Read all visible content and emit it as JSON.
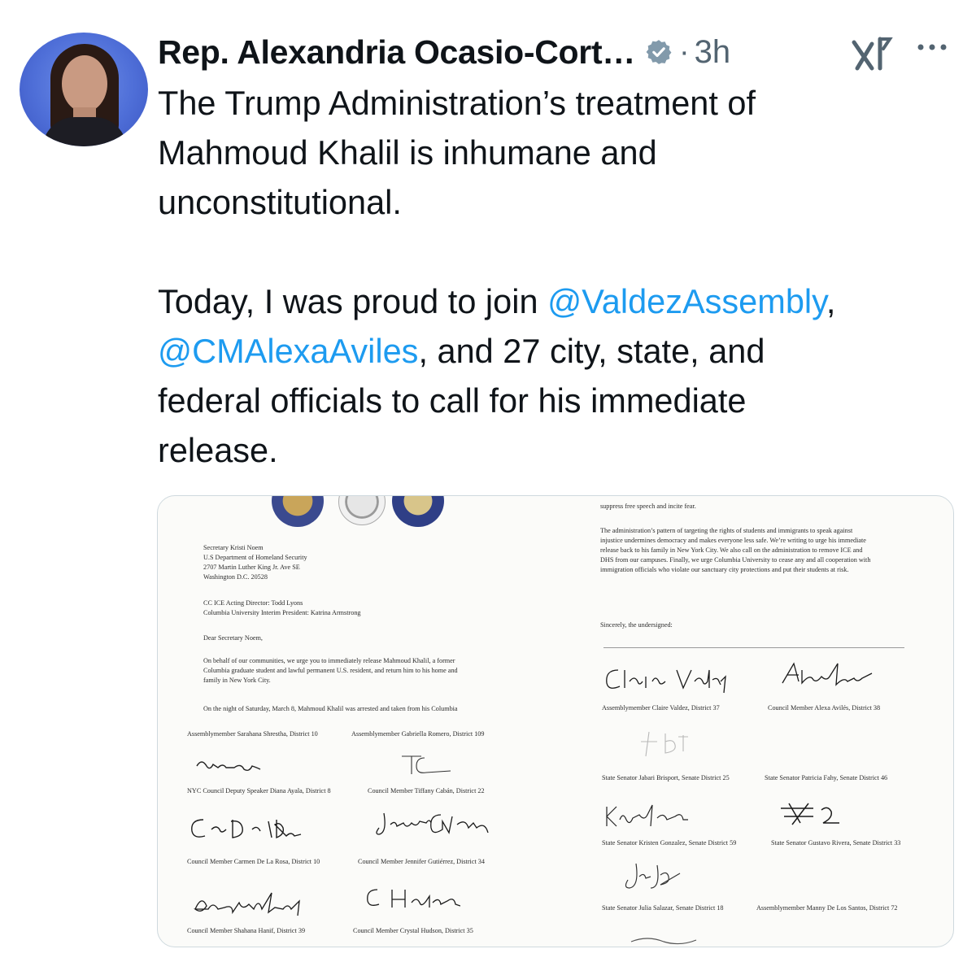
{
  "author": {
    "name": "Rep. Alexandria Ocasio-Cort…",
    "separator": "·",
    "time": "3h"
  },
  "icons": {
    "verified": "verified-badge-icon",
    "grok": "grok-icon",
    "more": "more-icon"
  },
  "colors": {
    "link": "#1d9bf0",
    "text": "#0f1419",
    "muted": "#536471"
  },
  "tweet": {
    "line1": "The Trump Administration’s treatment of",
    "line2": "Mahmoud Khalil is inhumane and",
    "line3": "unconstitutional.",
    "p2_before": "Today, I was proud to join ",
    "mention1": "@ValdezAssembly",
    "p2_comma": ",",
    "mention2": "@CMAlexaAviles",
    "p2_after": ", and 27 city, state, and",
    "line6": "federal officials to call for his immediate",
    "line7": "release."
  },
  "letter": {
    "addressee": [
      "Secretary Kristi Noem",
      "U.S Department of Homeland Security",
      "2707 Martin Luther King Jr. Ave SE",
      "Washington D.C. 20528"
    ],
    "cc": [
      "CC ICE Acting Director: Todd Lyons",
      "Columbia University Interim President: Katrina Armstrong"
    ],
    "salutation": "Dear Secretary Noem,",
    "body1": [
      "On behalf of our communities, we urge you to immediately release Mahmoud Khalil, a former",
      "Columbia graduate student and lawful permanent U.S. resident, and return him to his home and",
      "family in New York City."
    ],
    "body2": "On the night of Saturday, March 8, Mahmoud Khalil was arrested and taken from his Columbia",
    "right_top": "suppress free speech and incite fear.",
    "right_body": [
      "The administration’s pattern of targeting the rights of students and immigrants to speak against",
      "injustice undermines democracy and makes everyone less safe. We’re writing to urge his immediate",
      "release back to his family in New York City. We also call on the administration to remove ICE and",
      "DHS from our campuses. Finally, we urge Columbia University to cease any and all cooperation with",
      "immigration officials who violate our sanctuary city protections and put their students at risk."
    ],
    "closing": "Sincerely, the undersigned:",
    "signers_left": [
      "Assemblymember Sarahana Shrestha, District 10",
      "Assemblymember Gabriella Romero, District 109",
      "NYC Council Deputy Speaker Diana Ayala, District 8",
      "Council Member Tiffany Cabán, District 22",
      "Council Member Carmen De La Rosa, District 10",
      "Council Member Jennifer Gutiérrez, District 34",
      "Council Member Shahana Hanif, District 39",
      "Council Member Crystal Hudson, District 35"
    ],
    "signers_right": [
      "Assemblymember Claire Valdez, District 37",
      "Council Member Alexa Avilés, District 38",
      "State Senator Jabari Brisport, Senate District 25",
      "State Senator Patricia Fahy, Senate District 46",
      "State Senator Kristen Gonzalez, Senate District 59",
      "State Senator Gustavo Rivera, Senate District 33",
      "State Senator Julia Salazar, Senate District 18",
      "Assemblymember Manny De Los Santos, District 72"
    ]
  }
}
